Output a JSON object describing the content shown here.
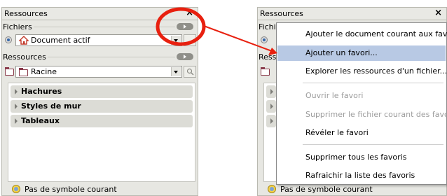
{
  "left_panel": {
    "title": "Ressources",
    "close_glyph": "×",
    "files_label": "Fichiers",
    "active_document": "Document actif",
    "resources_label": "Ressources",
    "root_folder": "Racine",
    "groups": [
      "Hachures",
      "Styles de mur",
      "Tableaux"
    ],
    "status": "Pas de symbole courant"
  },
  "right_panel": {
    "title": "Ressources",
    "close_glyph": "×",
    "files_label_partial": "Fichi",
    "resources_label_partial": "Ress",
    "status": "Pas de symbole courant"
  },
  "context_menu": {
    "items": [
      "Ajouter le document courant aux favoris",
      "Ajouter un favori...",
      "Explorer les ressources d'un fichier...",
      "Ouvrir le favori",
      "Supprimer le fichier courant des favoris",
      "Révéler le favori",
      "Supprimer tous les favoris",
      "Rafraichir la liste des favoris"
    ],
    "highlighted_index": 1,
    "disabled": [
      3,
      4
    ]
  },
  "colors": {
    "annotation": "#e8200f",
    "highlight": "#b8c9e4",
    "panel_bg": "#e7e7e2"
  },
  "icons": [
    "radio-icon",
    "home-icon",
    "folder-icon",
    "search-icon",
    "close-icon",
    "toggle-icon",
    "dropdown-arrow-icon",
    "status-symbol-icon",
    "expand-arrow-icon"
  ]
}
